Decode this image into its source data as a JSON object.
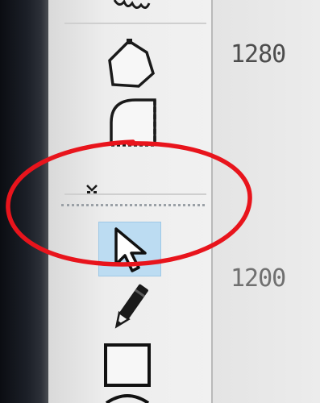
{
  "ruler": {
    "labels": [
      "1280",
      "1200"
    ]
  },
  "toolbar": {
    "tools": [
      {
        "icon": "cloud-shape-icon"
      },
      {
        "icon": "polygon-shape-icon"
      },
      {
        "icon": "rounded-corner-shape-icon"
      },
      {
        "icon": "collapsed-group-marker-icon"
      },
      {
        "icon": "select-arrow-icon",
        "selected": true
      },
      {
        "icon": "pencil-icon"
      },
      {
        "icon": "rectangle-icon"
      },
      {
        "icon": "ellipse-icon"
      }
    ]
  },
  "colors": {
    "selected_tool_bg": "#bcdcf2",
    "annotation_circle": "#e8141c"
  }
}
